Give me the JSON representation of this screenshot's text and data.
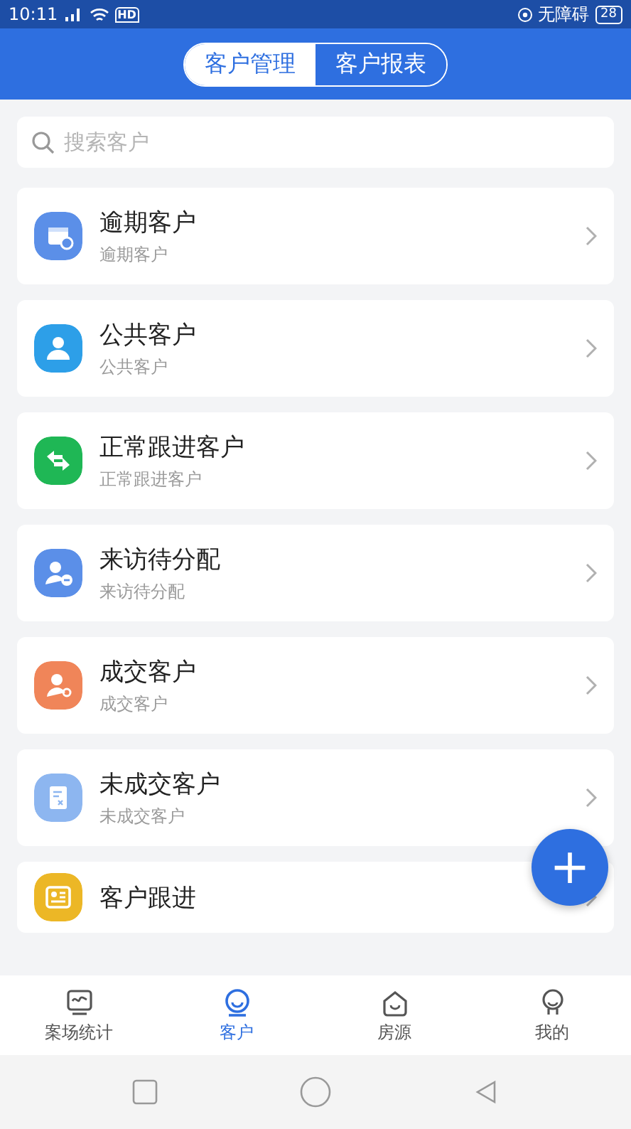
{
  "status_bar": {
    "time": "10:11",
    "network": "HD",
    "accessibility": "无障碍",
    "battery": "28"
  },
  "tabs": [
    {
      "label": "客户管理",
      "selected": true
    },
    {
      "label": "客户报表",
      "selected": false
    }
  ],
  "search": {
    "placeholder": "搜索客户"
  },
  "categories": [
    {
      "title": "逾期客户",
      "subtitle": "逾期客户",
      "color": "#5b8fe8"
    },
    {
      "title": "公共客户",
      "subtitle": "公共客户",
      "color": "#2d9fe8"
    },
    {
      "title": "正常跟进客户",
      "subtitle": "正常跟进客户",
      "color": "#1fb755"
    },
    {
      "title": "来访待分配",
      "subtitle": "来访待分配",
      "color": "#5b8fe8"
    },
    {
      "title": "成交客户",
      "subtitle": "成交客户",
      "color": "#f08559"
    },
    {
      "title": "未成交客户",
      "subtitle": "未成交客户",
      "color": "#8db6f0"
    },
    {
      "title": "客户跟进",
      "color": "#ecb726"
    }
  ],
  "fab": {
    "label": "+"
  },
  "bottom_nav": [
    {
      "label": "案场统计",
      "selected": false
    },
    {
      "label": "客户",
      "selected": true
    },
    {
      "label": "房源",
      "selected": false
    },
    {
      "label": "我的",
      "selected": false
    }
  ]
}
